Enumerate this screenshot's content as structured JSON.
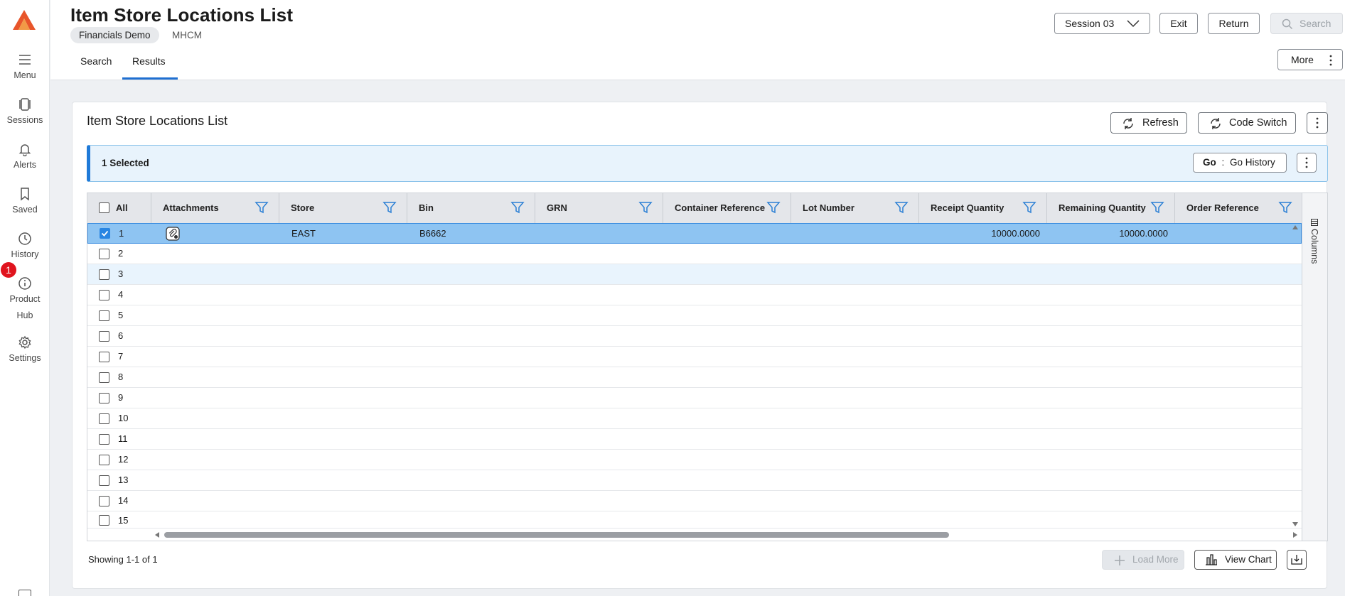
{
  "rail": {
    "items": [
      {
        "label": "Menu",
        "icon": "menu-icon"
      },
      {
        "label": "Sessions",
        "icon": "sessions-icon"
      },
      {
        "label": "Alerts",
        "icon": "bell-icon"
      },
      {
        "label": "Saved",
        "icon": "bookmark-icon"
      },
      {
        "label": "History",
        "icon": "clock-icon"
      },
      {
        "label": "Product",
        "label2": "Hub",
        "icon": "info-icon"
      },
      {
        "label": "Settings",
        "icon": "gear-icon"
      }
    ],
    "badge": "1"
  },
  "header": {
    "title": "Item Store Locations List",
    "chip": "Financials Demo",
    "code": "MHCM",
    "tabs": [
      {
        "label": "Search"
      },
      {
        "label": "Results"
      }
    ],
    "session_label": "Session 03",
    "exit_label": "Exit",
    "return_label": "Return",
    "search_label": "Search",
    "more_label": "More"
  },
  "card": {
    "title": "Item Store Locations List",
    "refresh_label": "Refresh",
    "code_switch_label": "Code Switch",
    "selected_label": "1 Selected",
    "go_prefix": "Go",
    "go_sep": ":",
    "go_label": "Go History",
    "footer_text": "Showing 1-1 of 1",
    "load_more_label": "Load More",
    "view_chart_label": "View Chart"
  },
  "grid": {
    "all_label": "All",
    "columns": [
      "Attachments",
      "Store",
      "Bin",
      "GRN",
      "Container Reference",
      "Lot Number",
      "Receipt Quantity",
      "Remaining Quantity",
      "Order Reference"
    ],
    "columns_panel_label": "Columns",
    "row1": {
      "num": "1",
      "store": "EAST",
      "bin": "B6662",
      "grn": "",
      "container_ref": "",
      "lot": "",
      "receipt_qty": "10000.0000",
      "remaining_qty": "10000.0000",
      "order_ref": ""
    },
    "row_numbers": [
      "2",
      "3",
      "4",
      "5",
      "6",
      "7",
      "8",
      "9",
      "10",
      "11",
      "12",
      "13",
      "14",
      "15"
    ]
  },
  "colors": {
    "accent": "#1f6fd1",
    "selected_row": "#8ec4f2",
    "badge": "#e0141e",
    "logo": "#e8552a"
  }
}
